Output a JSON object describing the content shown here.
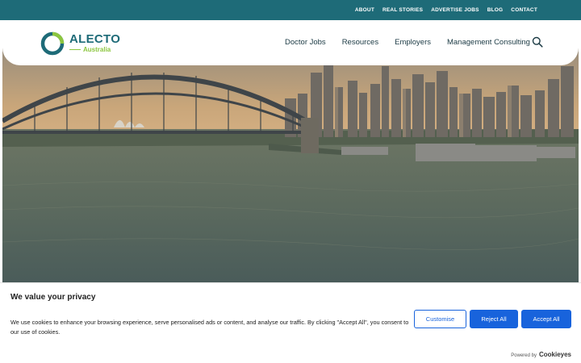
{
  "topnav": {
    "items": [
      "ABOUT",
      "REAL STORIES",
      "ADVERTISE JOBS",
      "BLOG",
      "CONTACT"
    ]
  },
  "brand": {
    "name": "ALECTO",
    "sub": "Australia",
    "colors": {
      "primary": "#1e6b78",
      "accent": "#8cc63f"
    }
  },
  "mainnav": {
    "items": [
      "Doctor Jobs",
      "Resources",
      "Employers",
      "Management Consulting"
    ],
    "search_icon": "search-icon"
  },
  "hero": {
    "image": "sydney-harbour-bridge-aerial"
  },
  "cookie_banner": {
    "title": "We value your privacy",
    "text": "We use cookies to enhance your browsing experience, serve personalised ads or content, and analyse our traffic. By clicking \"Accept All\", you consent to our use of cookies.",
    "buttons": {
      "customise": "Customise",
      "reject": "Reject All",
      "accept": "Accept All"
    },
    "powered_by": "Powered by",
    "powered_brand": "Cookieyes",
    "colors": {
      "button": "#1863dc"
    }
  }
}
